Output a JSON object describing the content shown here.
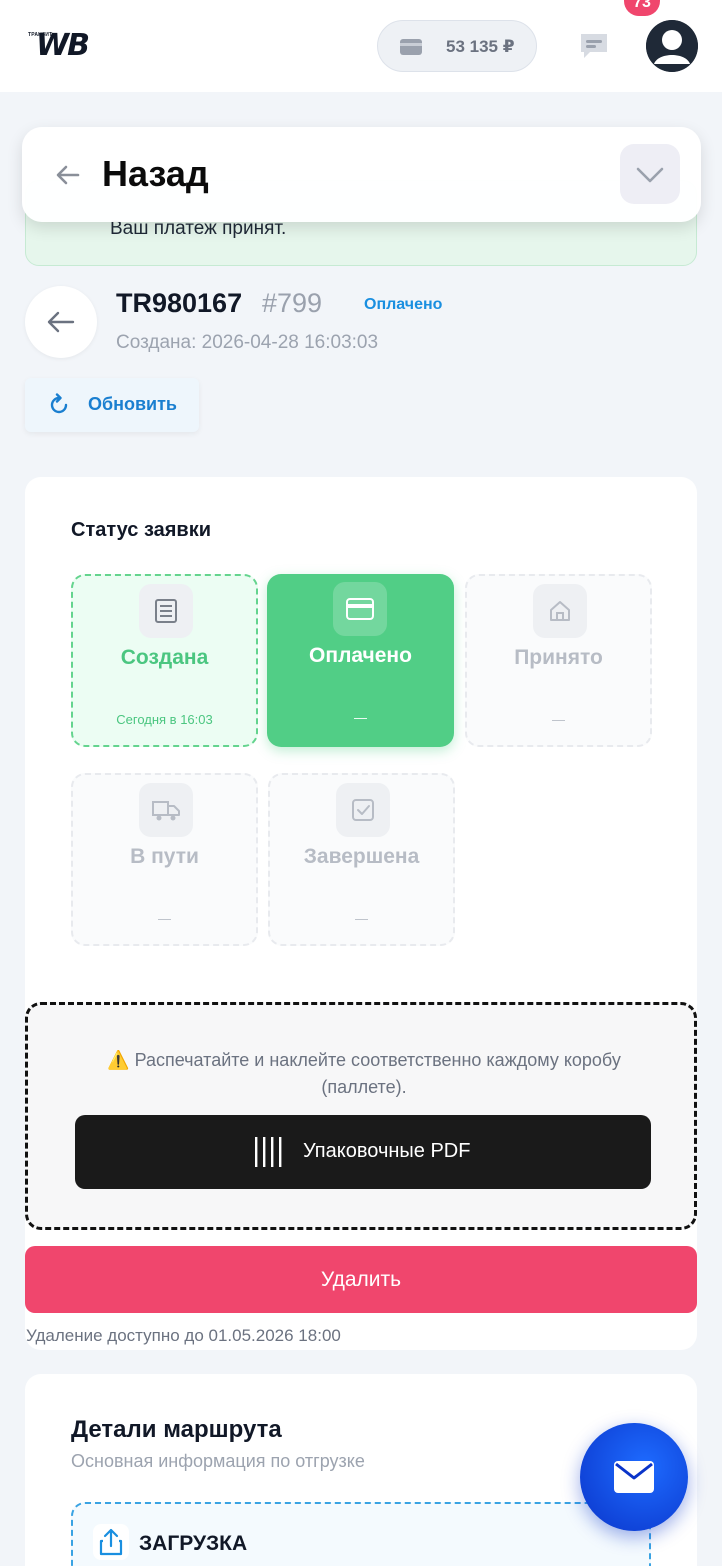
{
  "header": {
    "logo_small": "ТРАНЗИТ",
    "logo_big": "WB",
    "balance": "53 135 ₽",
    "notification_count": "73"
  },
  "back_sheet": {
    "title": "Назад"
  },
  "payment_banner": {
    "text": "Ваш платеж принят."
  },
  "order": {
    "id": "TR980167",
    "number": "#799",
    "status": "Оплачено",
    "created": "Создана: 2026-04-28 16:03:03"
  },
  "refresh": {
    "label": "Обновить"
  },
  "status_section": {
    "title": "Статус заявки",
    "steps": [
      {
        "label": "Создана",
        "date": "Сегодня в 16:03",
        "state": "done",
        "icon": "receipt-icon"
      },
      {
        "label": "Оплачено",
        "date": "—",
        "state": "active",
        "icon": "card-icon"
      },
      {
        "label": "Принято",
        "date": "—",
        "state": "pending",
        "icon": "home-icon"
      },
      {
        "label": "В пути",
        "date": "—",
        "state": "pending",
        "icon": "truck-icon"
      },
      {
        "label": "Завершена",
        "date": "—",
        "state": "pending",
        "icon": "checkbox-icon"
      }
    ]
  },
  "pdf_section": {
    "note": "Распечатайте и наклейте соответственно каждому коробу (паллете).",
    "button_label": "Упаковочные PDF"
  },
  "delete": {
    "label": "Удалить",
    "note": "Удаление доступно до 01.05.2026 18:00"
  },
  "route": {
    "title": "Детали маршрута",
    "subtitle": "Основная информация по отгрузке",
    "load_label": "ЗАГРУЗКА"
  },
  "colors": {
    "accent_green": "#51ce86",
    "accent_blue": "#1a8fe0",
    "danger": "#f0466d",
    "fab_blue": "#0a34c9"
  }
}
